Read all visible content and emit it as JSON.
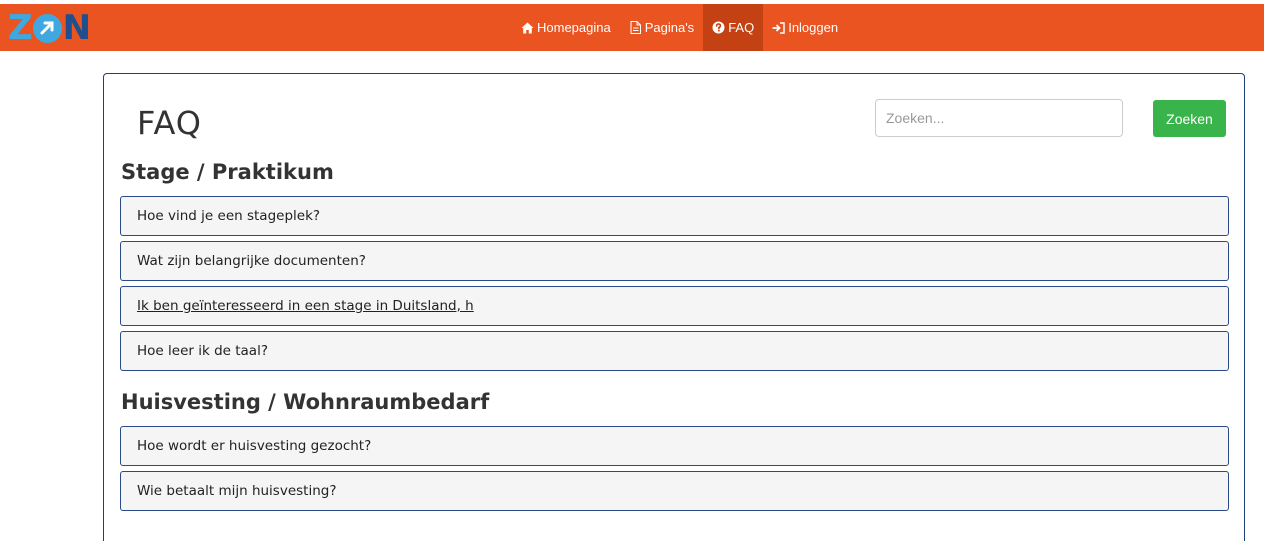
{
  "brand": {
    "logo_text": "ZON"
  },
  "nav": {
    "items": [
      {
        "label": "Homepagina",
        "icon": "home-icon"
      },
      {
        "label": "Pagina's",
        "icon": "file-icon"
      },
      {
        "label": "FAQ",
        "icon": "question-circle-icon",
        "active": true
      },
      {
        "label": "Inloggen",
        "icon": "sign-in-icon"
      }
    ]
  },
  "page": {
    "title": "FAQ"
  },
  "search": {
    "placeholder": "Zoeken...",
    "value": "",
    "button_label": "Zoeken"
  },
  "sections": [
    {
      "title": "Stage / Praktikum",
      "questions": [
        "Hoe vind je een stageplek?",
        "Wat zijn belangrijke documenten?",
        "Ik ben geïnteresseerd in een stage in Duitsland, h",
        "Hoe leer ik de taal?"
      ]
    },
    {
      "title": "Huisvesting / Wohnraumbedarf",
      "questions": [
        "Hoe wordt er huisvesting gezocht?",
        "Wie betaalt mijn huisvesting?"
      ]
    }
  ],
  "colors": {
    "navbar": "#e95420",
    "nav_active": "#c34113",
    "search_button": "#38b44a",
    "panel_border": "#1f3f7a",
    "logo_blue": "#40a8e0",
    "logo_dark": "#1f4f8f"
  }
}
